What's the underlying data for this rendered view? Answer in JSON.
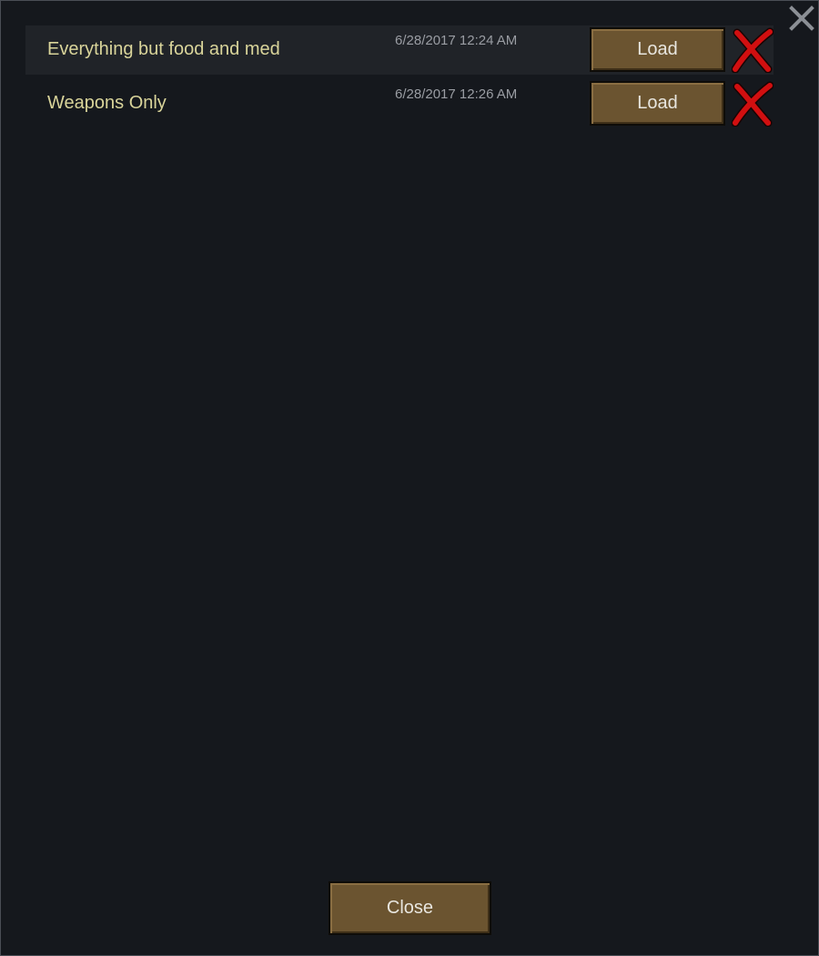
{
  "dialog": {
    "close_icon": "close-x-icon",
    "close_button_label": "Close"
  },
  "saved_filters": [
    {
      "name": "Everything but food and med",
      "date": "6/28/2017 12:24 AM",
      "load_label": "Load",
      "delete_icon": "red-x-delete-icon"
    },
    {
      "name": "Weapons Only",
      "date": "6/28/2017 12:26 AM",
      "load_label": "Load",
      "delete_icon": "red-x-delete-icon"
    }
  ],
  "colors": {
    "background": "#15181d",
    "row_highlight": "#202328",
    "name_text": "#d9d49a",
    "date_text": "#9a9da3",
    "button_fill": "#6b5430",
    "delete_red": "#d10f10"
  }
}
